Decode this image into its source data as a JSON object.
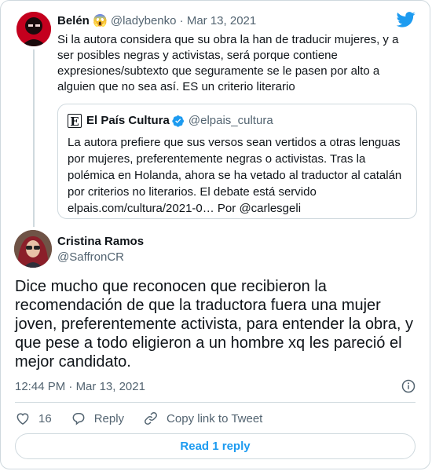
{
  "parent_tweet": {
    "name": "Belén 😱",
    "handle": "@ladybenko",
    "date": "Mar 13, 2021",
    "text": "Si la autora considera que su obra la han de traducir mujeres, y a ser posibles negras y activistas, será porque contiene expresiones/subtexto que seguramente se le pasen por alto a alguien que no sea así. ES un criterio literario"
  },
  "quoted_tweet": {
    "logo_letter": "E",
    "name": "El País Cultura",
    "handle": "@elpais_cultura",
    "text": "La autora prefiere que sus versos sean vertidos a otras lenguas por mujeres, preferentemente negras o activistas. Tras la polémica en Holanda, ahora se ha vetado al traductor al catalán por criterios no literarios. El debate está servido elpais.com/cultura/2021-0… Por @carlesgeli"
  },
  "main_tweet": {
    "name": "Cristina Ramos",
    "handle": "@SaffronCR",
    "text": "Dice mucho que reconocen que recibieron la recomendación de que la traductora fuera una mujer joven, preferentemente activista, para entender la obra, y que pese a todo eligieron a un hombre xq les pareció el mejor candidato.",
    "time": "12:44 PM",
    "date": "Mar 13, 2021",
    "separator": " · "
  },
  "actions": {
    "likes_count": "16",
    "reply_label": "Reply",
    "copy_link_label": "Copy link to Tweet"
  },
  "read_replies_label": "Read 1 reply",
  "colors": {
    "accent": "#1d9bf0",
    "muted": "#536471",
    "border": "#cfd9de"
  },
  "icons": [
    "twitter-bird-icon",
    "verified-badge-icon",
    "info-icon",
    "heart-icon",
    "reply-icon",
    "link-icon"
  ]
}
